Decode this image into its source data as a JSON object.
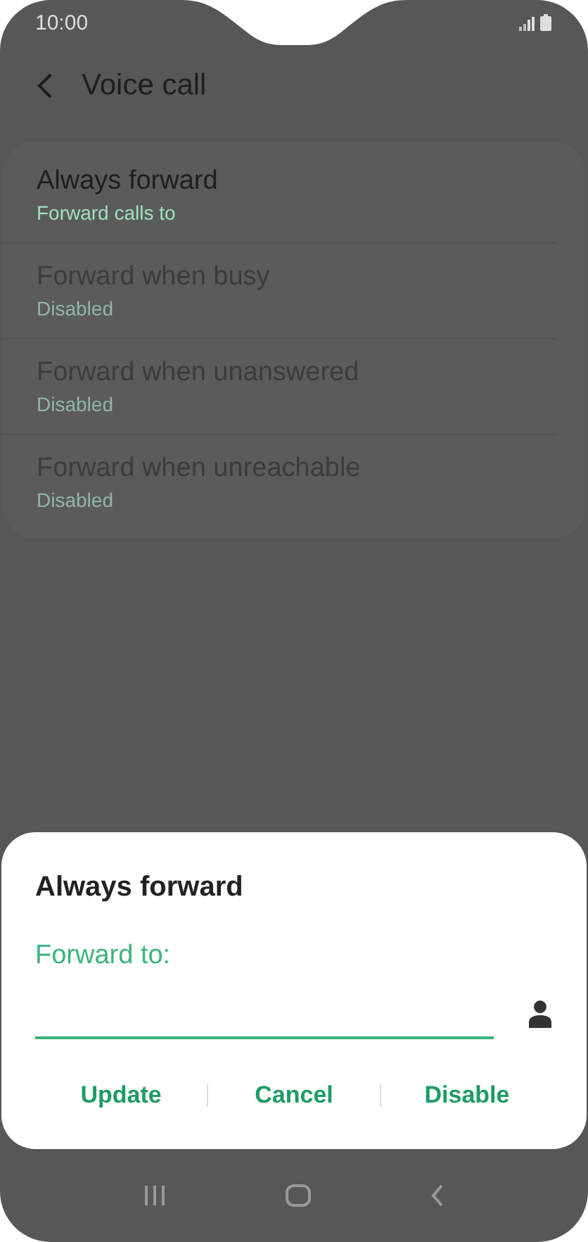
{
  "status_bar": {
    "time": "10:00"
  },
  "header": {
    "title": "Voice call"
  },
  "settings": [
    {
      "title": "Always forward",
      "subtitle": "Forward calls to",
      "disabled": false
    },
    {
      "title": "Forward when busy",
      "subtitle": "Disabled",
      "disabled": true
    },
    {
      "title": "Forward when unanswered",
      "subtitle": "Disabled",
      "disabled": true
    },
    {
      "title": "Forward when unreachable",
      "subtitle": "Disabled",
      "disabled": true
    }
  ],
  "dialog": {
    "title": "Always forward",
    "field_label": "Forward to:",
    "buttons": [
      "Update",
      "Cancel",
      "Disable"
    ]
  }
}
